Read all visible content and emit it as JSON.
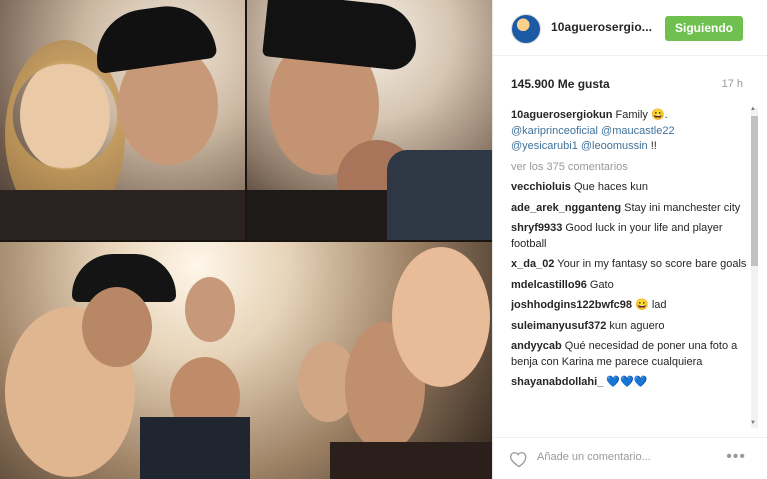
{
  "post": {
    "username": "10aguerosergio...",
    "follow_label": "Siguiendo",
    "likes": "145.900 Me gusta",
    "time": "17 h"
  },
  "caption": {
    "user": "10aguerosergiokun",
    "text": " Family 😀.",
    "mentions_line1": "@kariprinceoficial @maucastle22",
    "mentions_line2": "@yesicarubi1 @leoomussin",
    "suffix": " !!"
  },
  "view_all": "ver los 375 comentarios",
  "comments": [
    {
      "user": "vecchioluis",
      "text": " Que haces kun"
    },
    {
      "user": "ade_arek_ngganteng",
      "text": " Stay ini manchester city"
    },
    {
      "user": "shryf9933",
      "text": " Good luck in your life and player football"
    },
    {
      "user": "x_da_02",
      "text": " Your in my fantasy so score bare goals"
    },
    {
      "user": "mdelcastillo96",
      "text": " Gato"
    },
    {
      "user": "joshhodgins122bwfc98",
      "text": " 😀 lad"
    },
    {
      "user": "suleimanyusuf372",
      "text": " kun aguero"
    },
    {
      "user": "andyycab",
      "text": " Qué necesidad de poner una foto a benja con Karina me parece cualquiera"
    },
    {
      "user": "shayanabdollahi_",
      "text": " 💙💙💙"
    }
  ],
  "footer": {
    "add_comment_placeholder": "Añade un comentario...",
    "more_label": "•••"
  },
  "icons": {
    "heart": "heart-outline-icon",
    "more": "more-options-icon"
  },
  "colors": {
    "follow_button": "#70c050",
    "mention": "#3f729b",
    "muted": "#999999"
  }
}
